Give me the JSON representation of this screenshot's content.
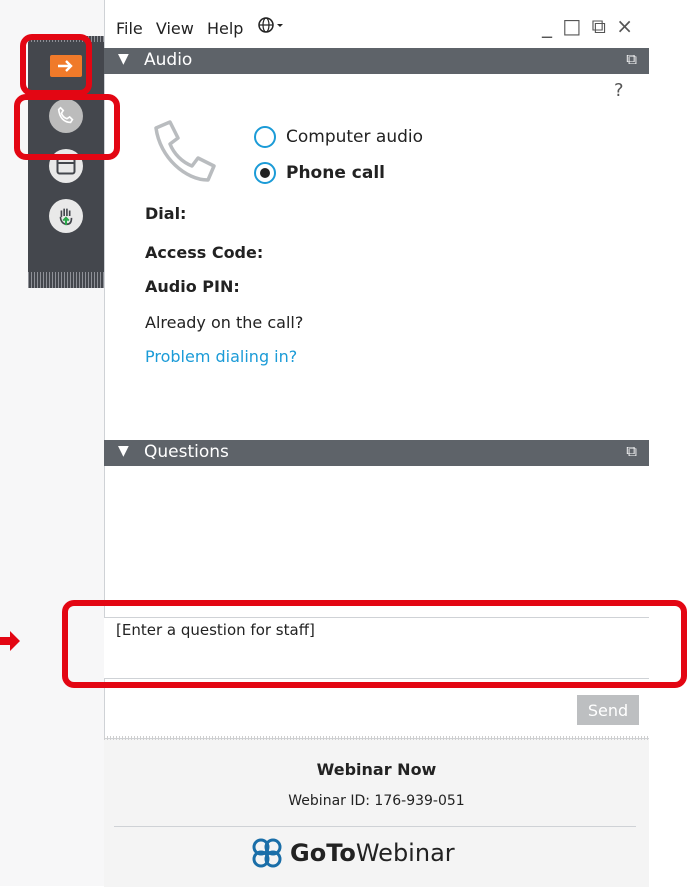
{
  "menu": {
    "file": "File",
    "view": "View",
    "help": "Help",
    "globe_icon": "globe-icon"
  },
  "window_controls": {
    "minimize": "_",
    "maximize": "□",
    "popout": "⧉",
    "close": "×"
  },
  "sidebar": {
    "items": [
      {
        "name": "exit-arrow",
        "icon": "arrow-right-icon",
        "color": "#f07a2a"
      },
      {
        "name": "audio",
        "icon": "phone-icon"
      },
      {
        "name": "screen",
        "icon": "window-icon"
      },
      {
        "name": "raise-hand",
        "icon": "hand-icon"
      }
    ]
  },
  "audio": {
    "title": "Audio",
    "help": "?",
    "options": [
      "Computer audio",
      "Phone call"
    ],
    "selected": "Phone call",
    "dial_label": "Dial:",
    "access_code_label": "Access Code:",
    "audio_pin_label": "Audio PIN:",
    "already_on_call": "Already on the call?",
    "problem_link": "Problem dialing in?"
  },
  "questions": {
    "title": "Questions",
    "input_placeholder": "[Enter a question for staff]",
    "send_label": "Send"
  },
  "footer": {
    "title": "Webinar Now",
    "webinar_id": "Webinar ID: 176-939-051",
    "brand_goto": "GoTo",
    "brand_webinar": "Webinar"
  },
  "colors": {
    "accent": "#1b9bd7",
    "annotation_red": "#e30613",
    "header": "#5e6369",
    "sidebar": "#44474d"
  }
}
